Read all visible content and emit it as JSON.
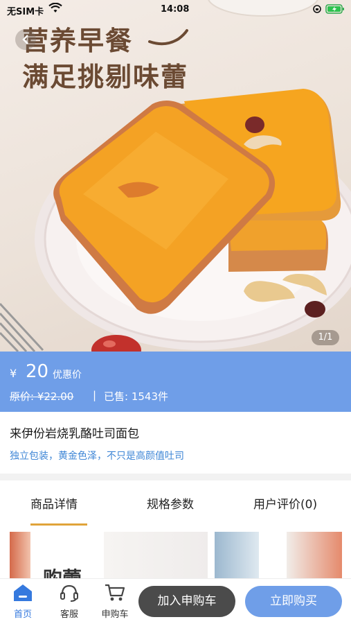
{
  "status_bar": {
    "carrier": "无SIM卡",
    "time": "14:08",
    "wifi_icon": "wifi-icon",
    "battery_icon": "battery-charging-icon"
  },
  "hero": {
    "headline_line1": "营养早餐",
    "headline_line2": "满足挑剔味蕾",
    "page_indicator": "1/1",
    "back_icon": "chevron-left-icon"
  },
  "price": {
    "currency": "¥",
    "amount": "20",
    "tag": "优惠价",
    "original_label": "原价: ¥22.00",
    "separator": "|",
    "sold_label": "已售: 1543件"
  },
  "product": {
    "title": "来伊份岩烧乳酪吐司面包",
    "subtitle": "独立包装，黄金色泽，不只是高颜值吐司"
  },
  "tabs": [
    {
      "label": "商品详情",
      "active": true
    },
    {
      "label": "规格参数",
      "active": false
    },
    {
      "label": "用户评价(0)",
      "active": false
    }
  ],
  "detail_preview": {
    "partial_text": "购蕾"
  },
  "bottom_bar": {
    "nav": [
      {
        "label": "首页",
        "icon": "home-icon",
        "active": true
      },
      {
        "label": "客服",
        "icon": "headset-icon",
        "active": false
      },
      {
        "label": "申购车",
        "icon": "cart-icon",
        "active": false
      }
    ],
    "add_to_cart": "加入申购车",
    "buy_now": "立即购买"
  },
  "colors": {
    "accent_blue": "#6f9ee8",
    "link_blue": "#3e86d6",
    "tab_underline": "#e0a33a",
    "headline_brown": "#6b4a33",
    "dark_button": "#4b4b4b"
  }
}
